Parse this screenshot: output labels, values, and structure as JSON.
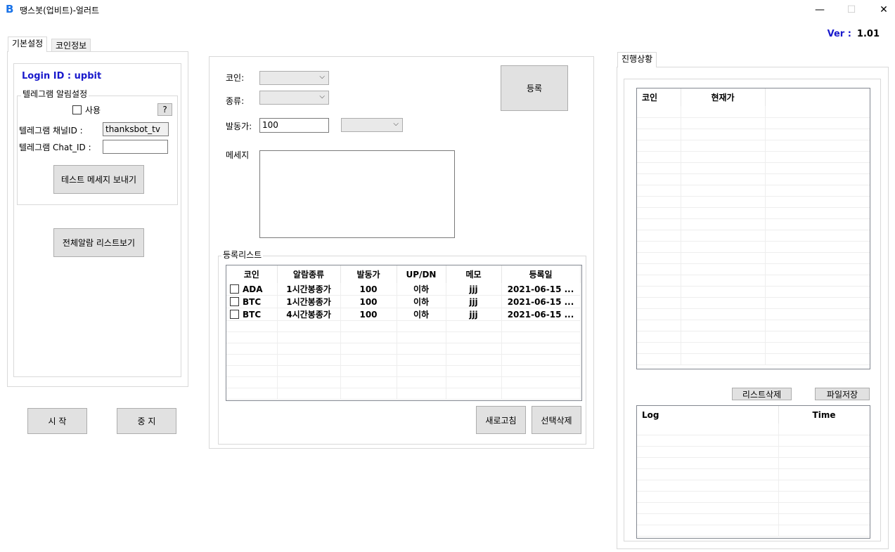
{
  "window": {
    "title": "땡스봇(업비트)-얼러트",
    "icon_letter": "B",
    "minimize": "—",
    "maximize": "☐",
    "close": "✕"
  },
  "version": {
    "label": "Ver :",
    "value": "1.01"
  },
  "left_tabs": [
    "기본설정",
    "코인정보"
  ],
  "login": {
    "label": "Login ID : upbit"
  },
  "telegram": {
    "group_title": "텔레그램 알림설정",
    "use_label": "사용",
    "help_label": "?",
    "channel_label": "텔레그램  채널ID :",
    "channel_value": "thanksbot_tv",
    "chat_label": "텔레그램  Chat_ID :",
    "chat_value": "",
    "test_button": "테스트 메세지 보내기"
  },
  "all_alarm_button": "전체알람 리스트보기",
  "start_button": "시 작",
  "stop_button": "중 지",
  "form": {
    "coin_label": "코인:",
    "type_label": "종류:",
    "trigger_label": "발동가:",
    "trigger_value": "100",
    "message_label": "메세지",
    "register_button": "등록"
  },
  "reg_list": {
    "title": "등록리스트",
    "columns": [
      "코인",
      "알람종류",
      "발동가",
      "UP/DN",
      "메모",
      "등록일"
    ],
    "rows": [
      [
        "ADA",
        "1시간봉종가",
        "100",
        "이하",
        "jjj",
        "2021-06-15 ..."
      ],
      [
        "BTC",
        "1시간봉종가",
        "100",
        "이하",
        "jjj",
        "2021-06-15 ..."
      ],
      [
        "BTC",
        "4시간봉종가",
        "100",
        "이하",
        "jjj",
        "2021-06-15 ..."
      ]
    ],
    "refresh_button": "새로고침",
    "delete_selected_button": "선택삭제"
  },
  "progress": {
    "tab": "진행상황",
    "columns": [
      "코인",
      "현재가"
    ],
    "list_delete_button": "리스트삭제",
    "file_save_button": "파일저장",
    "log_columns": [
      "Log",
      "Time"
    ]
  }
}
